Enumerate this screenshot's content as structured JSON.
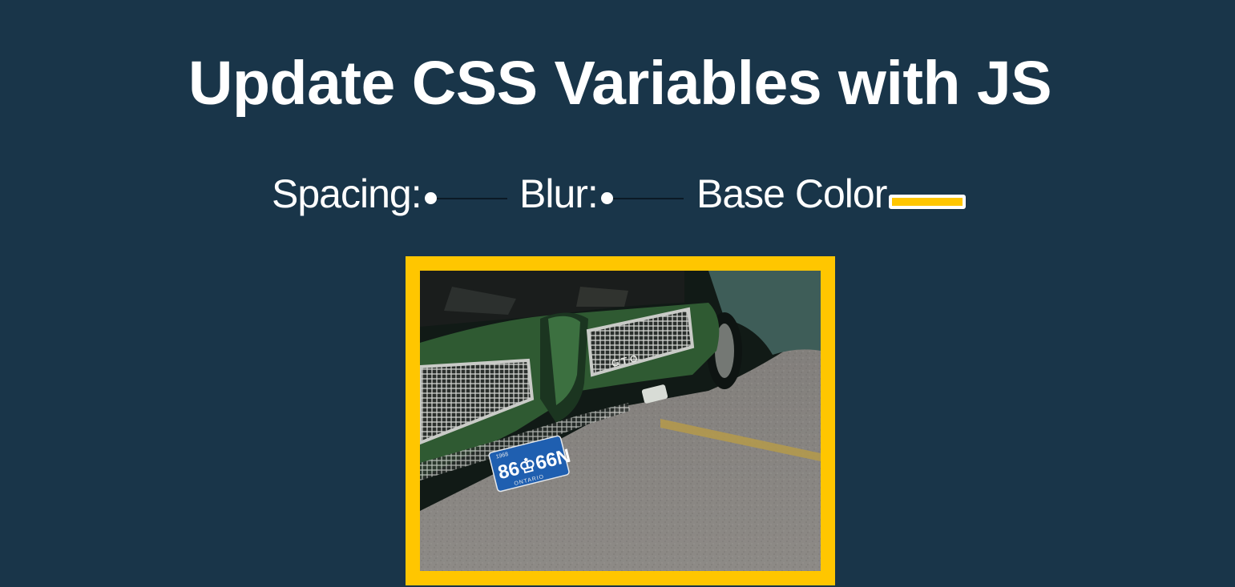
{
  "page": {
    "title": "Update CSS Variables with JS",
    "background": "#193549"
  },
  "controls": {
    "spacing": {
      "label": "Spacing:",
      "value": 10,
      "min": 10,
      "max": 200
    },
    "blur": {
      "label": "Blur:",
      "value": 0,
      "min": 0,
      "max": 25
    },
    "base_color": {
      "label": "Base Color",
      "value": "#ffc600"
    }
  },
  "image": {
    "plate_text": "86♔66N",
    "plate_region": "ONTARIO",
    "plate_year": "1968",
    "badge_text": "G T O",
    "colors": {
      "car_green": "#2f5a32",
      "car_green_dark": "#1b3520",
      "asphalt": "#8d8a86",
      "plate_blue": "#1f5fb0",
      "shadow": "#111a16",
      "chrome": "#c9cbc7",
      "road_line": "#b59a4a"
    }
  }
}
